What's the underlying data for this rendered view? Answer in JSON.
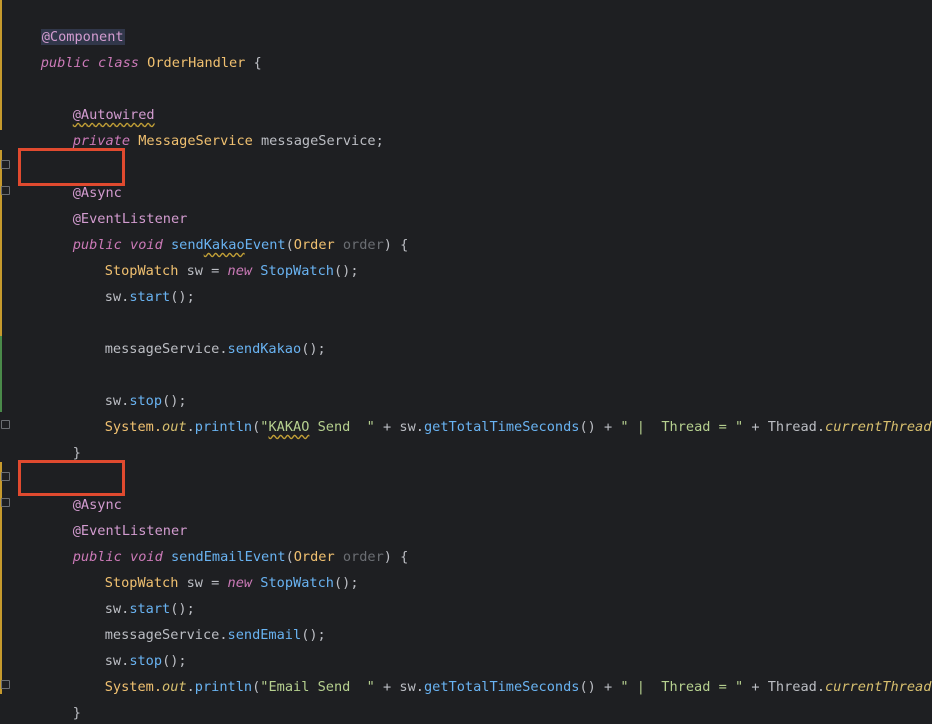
{
  "code": {
    "l0": {
      "ann": "@Component"
    },
    "l1": {
      "kw1": "public",
      "kw2": "class",
      "cls": "OrderHandler",
      "rest": " {"
    },
    "l3": {
      "ann": "@Autowired"
    },
    "l4": {
      "kw": "private",
      "cls": "MessageService",
      "rest": " messageService;"
    },
    "l6": {
      "ann": "@Async"
    },
    "l7": {
      "ann": "@EventListener"
    },
    "l8": {
      "kw1": "public",
      "kw2": "void",
      "name_pre": "send",
      "name_squig": "Kakao",
      "name_post": "Event",
      "open": "(",
      "type": "Order",
      "param": "order",
      "close": ") {"
    },
    "l9": {
      "cls1": "StopWatch",
      "var": " sw = ",
      "kw": "new",
      "cls2": "StopWatch",
      "rest": "();"
    },
    "l10": {
      "obj": "sw.",
      "method": "start",
      "rest": "();"
    },
    "l12": {
      "obj": "messageService.",
      "method": "sendKakao",
      "rest": "();"
    },
    "l14": {
      "obj": "sw.",
      "method": "stop",
      "rest": "();"
    },
    "l15": {
      "sys": "System.",
      "out": "out",
      "dot": ".",
      "println": "println",
      "open": "(",
      "str_pre": "\"",
      "str_squig": "KAKAO",
      "str_post": " Send  \"",
      "plus1": " + sw.",
      "m2": "getTotalTimeSeconds",
      "mid": "() + ",
      "str2": "\" |  Thread = \"",
      "plus2": " + Thread.",
      "static": "currentThread",
      "end": "());"
    },
    "l16": {
      "rest": "}"
    },
    "l18": {
      "ann": "@Async"
    },
    "l19": {
      "ann": "@EventListener"
    },
    "l20": {
      "kw1": "public",
      "kw2": "void",
      "name": "sendEmailEvent",
      "open": "(",
      "type": "Order",
      "param": "order",
      "close": ") {"
    },
    "l21": {
      "cls1": "StopWatch",
      "var": " sw = ",
      "kw": "new",
      "cls2": "StopWatch",
      "rest": "();"
    },
    "l22": {
      "obj": "sw.",
      "method": "start",
      "rest": "();"
    },
    "l23": {
      "obj": "messageService.",
      "method": "sendEmail",
      "rest": "();"
    },
    "l24": {
      "obj": "sw.",
      "method": "stop",
      "rest": "();"
    },
    "l25": {
      "sys": "System.",
      "out": "out",
      "dot": ".",
      "println": "println",
      "open": "(",
      "str": "\"Email Send  \"",
      "plus1": " + sw.",
      "m2": "getTotalTimeSeconds",
      "mid": "() + ",
      "str2": "\" |  Thread = \"",
      "plus2": " + Thread.",
      "static": "currentThread",
      "end": "());"
    },
    "l26": {
      "rest": "}"
    },
    "l27": {
      "rest": "}"
    }
  },
  "colors": {
    "highlight_box": "#e04a2f",
    "background": "#1e1f22"
  }
}
